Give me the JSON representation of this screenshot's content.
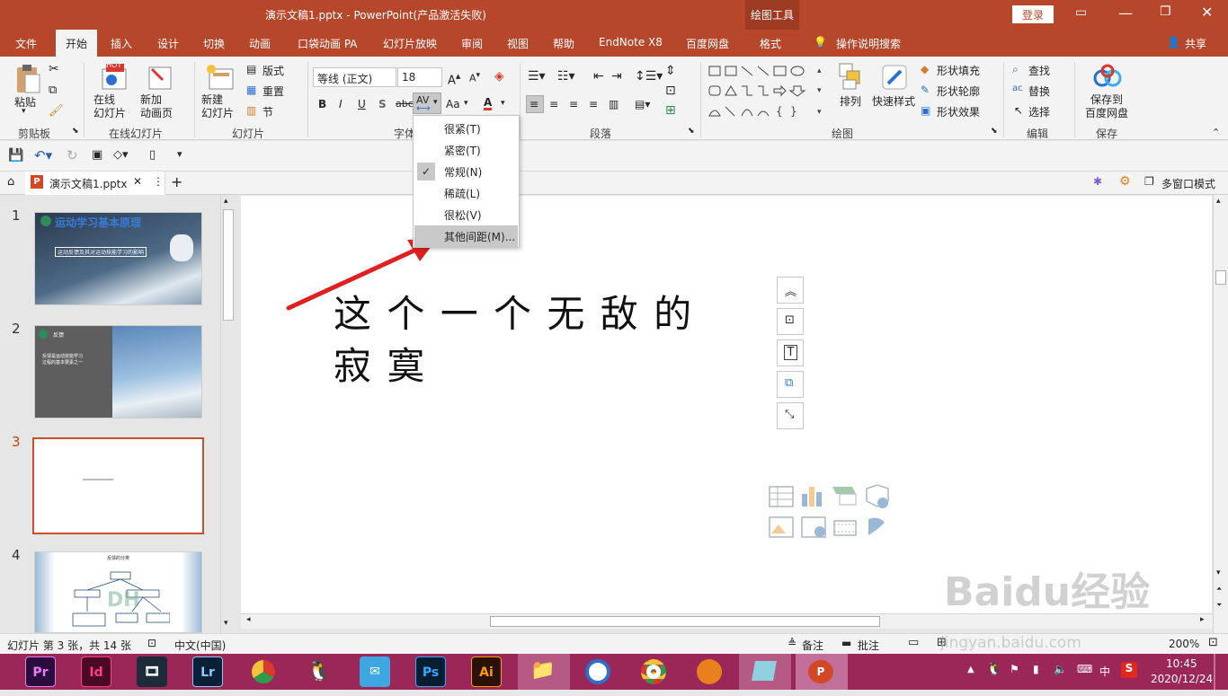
{
  "title_bar": {
    "title": "演示文稿1.pptx  -  PowerPoint(产品激活失败)",
    "contextual_label": "绘图工具",
    "login": "登录"
  },
  "tabs": [
    "文件",
    "开始",
    "插入",
    "设计",
    "切换",
    "动画",
    "口袋动画 PA",
    "幻灯片放映",
    "审阅",
    "视图",
    "帮助",
    "EndNote X8",
    "百度网盘",
    "格式"
  ],
  "tell_me": "操作说明搜索",
  "share": "共享",
  "ribbon": {
    "clipboard": {
      "paste": "粘贴",
      "label": "剪贴板"
    },
    "online": {
      "online_slide": "在线\n幻灯片",
      "new_anim": "新加\n动画页",
      "label": "在线幻灯片",
      "hot": "HOT"
    },
    "slides": {
      "new_slide": "新建\n幻灯片",
      "layout": "版式",
      "reset": "重置",
      "section": "节",
      "label": "幻灯片"
    },
    "font": {
      "font_name": "等线 (正文)",
      "font_size": "18",
      "label": "字体",
      "bold": "B",
      "italic": "I",
      "underline": "U",
      "shadow": "S",
      "strike": "abc",
      "spacing": "AV",
      "case": "Aa"
    },
    "paragraph": {
      "label": "段落"
    },
    "drawing": {
      "arrange": "排列",
      "quick_styles": "快速样式",
      "fill": "形状填充",
      "outline": "形状轮廓",
      "effects": "形状效果",
      "label": "绘图"
    },
    "editing": {
      "find": "查找",
      "replace": "替换",
      "select": "选择",
      "label": "编辑"
    },
    "save": {
      "save_baidu": "保存到\n百度网盘",
      "label": "保存"
    }
  },
  "doc_tab": {
    "name": "演示文稿1.pptx",
    "multi_window": "多窗口模式"
  },
  "spacing_menu": {
    "items": [
      {
        "label": "很紧(T)",
        "checked": false,
        "hover": false
      },
      {
        "label": "紧密(T)",
        "checked": false,
        "hover": false
      },
      {
        "label": "常规(N)",
        "checked": true,
        "hover": false
      },
      {
        "label": "稀疏(L)",
        "checked": false,
        "hover": false
      },
      {
        "label": "很松(V)",
        "checked": false,
        "hover": false
      },
      {
        "label": "其他间距(M)...",
        "checked": false,
        "hover": true
      }
    ]
  },
  "slides": [
    {
      "num": "1",
      "title": "运动学习基本原理",
      "subtitle": "运动反馈及其对运动技能学习的影响"
    },
    {
      "num": "2",
      "title": "反馈",
      "body": "反馈是运动技能学习\n过程的基本要素之一"
    },
    {
      "num": "3"
    },
    {
      "num": "4",
      "title": "反馈的分类"
    }
  ],
  "slide_text_line1": "这 个 一 个 无 敌 的",
  "slide_text_line2": "寂 寞",
  "status": {
    "slide_info": "幻灯片 第 3 张，共 14 张",
    "language": "中文(中国)",
    "notes": "备注",
    "comments": "批注",
    "zoom": "200%"
  },
  "taskbar": {
    "apps": [
      "Pr",
      "Id",
      "",
      "Lr",
      "",
      "",
      "",
      "Ps",
      "Ai",
      "",
      "",
      "",
      "",
      "",
      ""
    ],
    "time": "10:45",
    "date": "2020/12/24",
    "ime": "中"
  },
  "watermark": {
    "brand": "Baidu经验",
    "url": "jingyan.baidu.com"
  },
  "colors": {
    "accent": "#b7472a",
    "taskbar": "#9b2758",
    "selection": "#c8c8c8"
  }
}
